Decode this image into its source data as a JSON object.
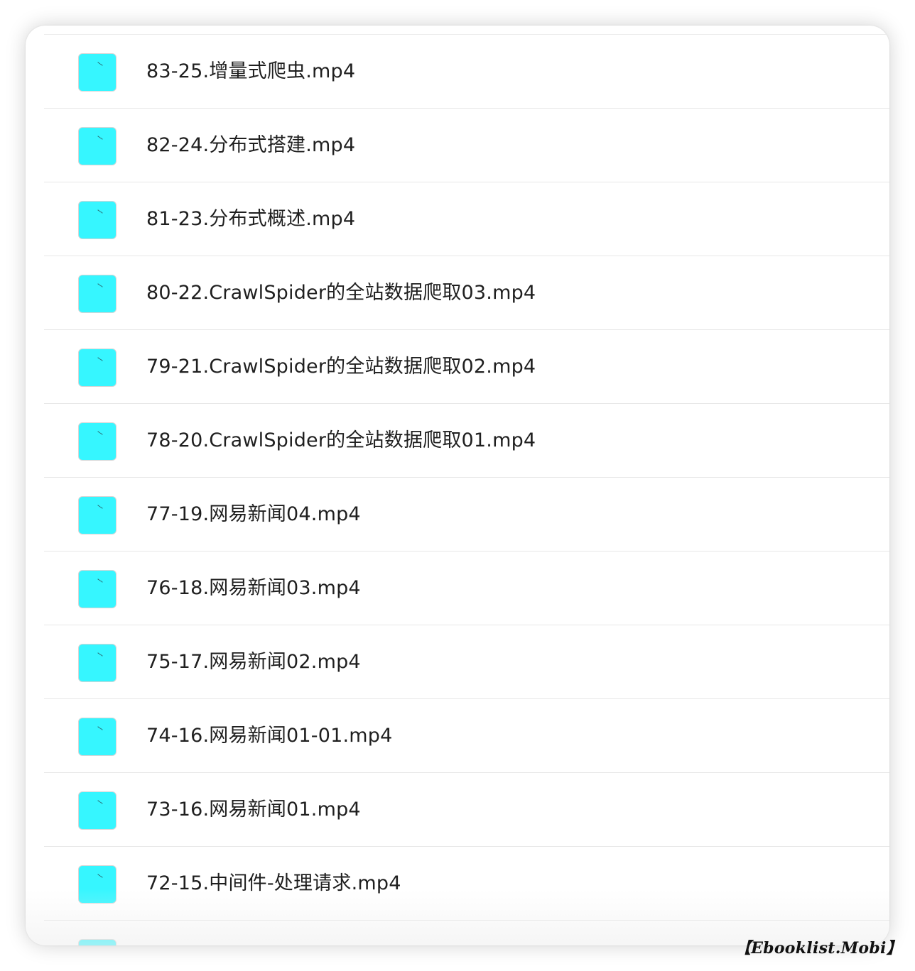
{
  "file_icon": {
    "icon_name": "video-file-icon",
    "color": "#36f6ff"
  },
  "files": [
    {
      "name": "83-25.增量式爬虫.mp4"
    },
    {
      "name": "82-24.分布式搭建.mp4"
    },
    {
      "name": "81-23.分布式概述.mp4"
    },
    {
      "name": "80-22.CrawlSpider的全站数据爬取03.mp4"
    },
    {
      "name": "79-21.CrawlSpider的全站数据爬取02.mp4"
    },
    {
      "name": "78-20.CrawlSpider的全站数据爬取01.mp4"
    },
    {
      "name": "77-19.网易新闻04.mp4"
    },
    {
      "name": "76-18.网易新闻03.mp4"
    },
    {
      "name": "75-17.网易新闻02.mp4"
    },
    {
      "name": "74-16.网易新闻01-01.mp4"
    },
    {
      "name": "73-16.网易新闻01.mp4"
    },
    {
      "name": "72-15.中间件-处理请求.mp4"
    },
    {
      "name": ""
    }
  ],
  "watermark": {
    "text": "【Ebooklist.Mobi】"
  }
}
